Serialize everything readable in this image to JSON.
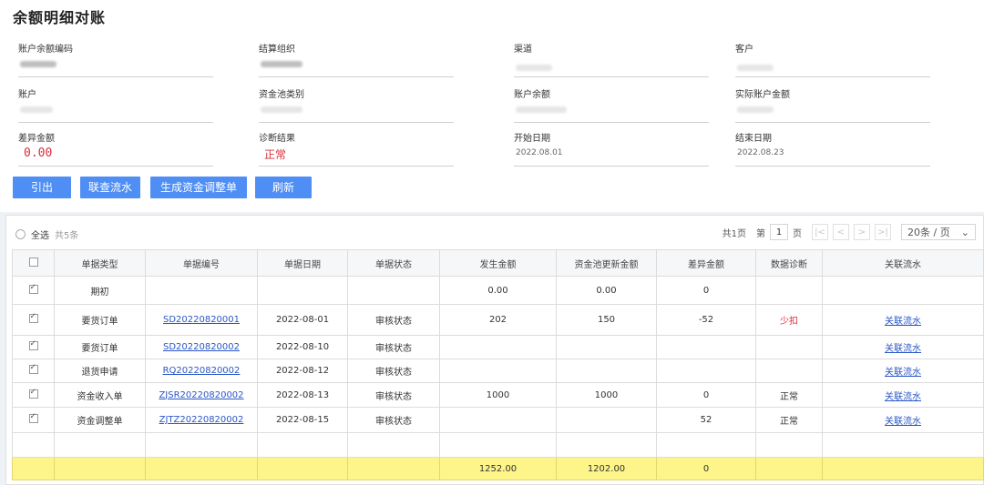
{
  "page_title": "余额明细对账",
  "fields": {
    "account_balance_code": {
      "label": "账户余额编码"
    },
    "settlement_org": {
      "label": "结算组织"
    },
    "channel": {
      "label": "渠道"
    },
    "customer": {
      "label": "客户"
    },
    "account": {
      "label": "账户"
    },
    "fund_pool_type": {
      "label": "资金池类别"
    },
    "account_balance": {
      "label": "账户余额"
    },
    "actual_account_amount": {
      "label": "实际账户金额"
    },
    "diff_amount": {
      "label": "差异金额",
      "value": "0.00"
    },
    "diagnosis_result": {
      "label": "诊断结果",
      "value": "正常"
    },
    "start_date": {
      "label": "开始日期",
      "value": "2022.08.01"
    },
    "end_date": {
      "label": "结束日期",
      "value": "2022.08.23"
    }
  },
  "buttons": {
    "export": "引出",
    "query_flow": "联查流水",
    "generate_adjustment": "生成资金调整单",
    "refresh": "刷新"
  },
  "toolbar": {
    "select_all": "全选",
    "total_count": "共5条"
  },
  "pagination": {
    "total_pages_prefix": "共1页",
    "page_prefix": "第",
    "current_page": "1",
    "page_suffix": "页",
    "page_size": "20条 / 页"
  },
  "table": {
    "headers": [
      "单据类型",
      "单据编号",
      "单据日期",
      "单据状态",
      "发生金额",
      "资金池更新金额",
      "差异金额",
      "数据诊断",
      "关联流水"
    ],
    "rows": [
      {
        "checked": true,
        "type": "期初",
        "code": "",
        "date": "",
        "status": "",
        "amount": "0.00",
        "pool_amount": "0.00",
        "diff": "0",
        "diagnosis": "",
        "flow": ""
      },
      {
        "checked": true,
        "type": "要货订单",
        "code": "SD20220820001",
        "date": "2022-08-01",
        "status": "审核状态",
        "amount": "202",
        "pool_amount": "150",
        "diff": "-52",
        "diagnosis": "少扣",
        "flow": "关联流水"
      },
      {
        "checked": true,
        "type": "要货订单",
        "code": "SD20220820002",
        "date": "2022-08-10",
        "status": "审核状态",
        "amount": "",
        "pool_amount": "",
        "diff": "",
        "diagnosis": "",
        "flow": "关联流水"
      },
      {
        "checked": true,
        "type": "退货申请",
        "code": "RQ20220820002",
        "date": "2022-08-12",
        "status": "审核状态",
        "amount": "",
        "pool_amount": "",
        "diff": "",
        "diagnosis": "",
        "flow": "关联流水"
      },
      {
        "checked": true,
        "type": "资金收入单",
        "code": "ZJSR20220820002",
        "date": "2022-08-13",
        "status": "审核状态",
        "amount": "1000",
        "pool_amount": "1000",
        "diff": "0",
        "diagnosis": "正常",
        "flow": "关联流水"
      },
      {
        "checked": true,
        "type": "资金调整单",
        "code": "ZJTZ20220820002",
        "date": "2022-08-15",
        "status": "审核状态",
        "amount": "",
        "pool_amount": "",
        "diff": "52",
        "diagnosis": "正常",
        "flow": "关联流水"
      }
    ],
    "summary": {
      "amount": "1252.00",
      "pool_amount": "1202.00",
      "diff": "0"
    }
  },
  "colors": {
    "primary_button": "#4f8ef5",
    "alert_red": "#d9303b",
    "summary_yellow": "#fdf58a",
    "link_blue": "#2a56c6"
  }
}
